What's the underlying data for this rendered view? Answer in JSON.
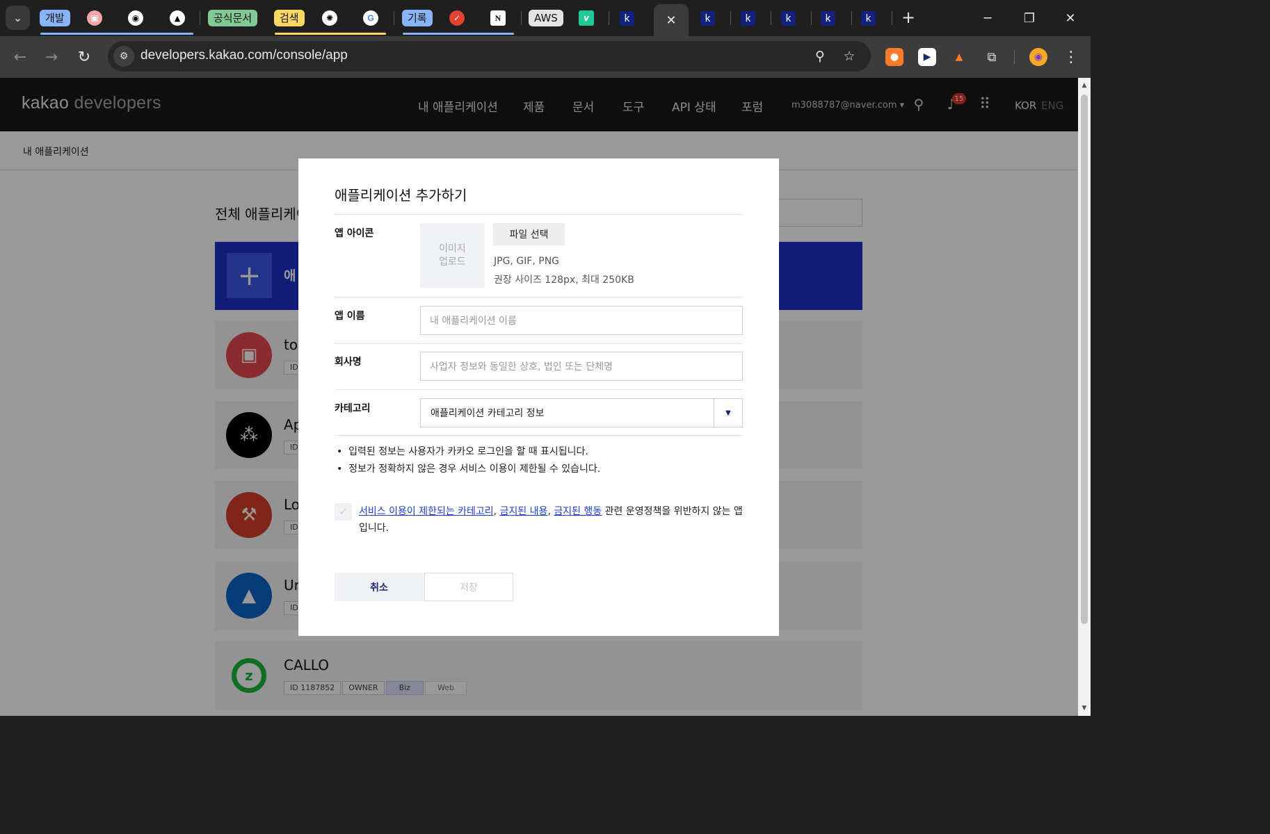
{
  "browser": {
    "tab_groups": [
      {
        "label": "개발",
        "color": "#8ab4f8"
      },
      {
        "label": "공식문서",
        "color": "#81c995"
      },
      {
        "label": "검색",
        "color": "#fdd663"
      },
      {
        "label": "기록",
        "color": "#8ab4f8"
      },
      {
        "label": "AWS",
        "color": "#e3e3e3"
      }
    ],
    "active_tab_close": "✕",
    "url": "developers.kakao.com/console/app",
    "new_tab": "+"
  },
  "header": {
    "logo_main": "kakao",
    "logo_sub": "developers",
    "nav": [
      "내 애플리케이션",
      "제품",
      "문서",
      "도구",
      "API 상태",
      "포럼"
    ],
    "email": "m3088787@naver.com",
    "email_caret": "▾",
    "notification_count": "15",
    "lang_kor": "KOR",
    "lang_eng": "ENG"
  },
  "breadcrumb": "내 애플리케이션",
  "page_title": "전체 애플리케이",
  "add_card_label": "애",
  "apps": [
    {
      "name": "toy",
      "color": "#e6484f",
      "icon": "gift-icon",
      "tags": [
        "ID"
      ]
    },
    {
      "name": "Ap",
      "color": "#000000",
      "icon": "dots-icon",
      "tags": [
        "ID"
      ]
    },
    {
      "name": "Lo",
      "color": "#d43e2a",
      "icon": "gavel-icon",
      "tags": [
        "ID"
      ]
    },
    {
      "name": "Ur",
      "color": "#0a64c7",
      "icon": "graduation-cap-icon",
      "tags": [
        "ID"
      ]
    },
    {
      "name": "CALLO",
      "color": "#19b83c",
      "icon": "callo-logo",
      "tags": [
        "ID 1187852",
        "OWNER",
        "Biz",
        "Web"
      ]
    }
  ],
  "modal": {
    "title": "애플리케이션 추가하기",
    "icon_label": "앱 아이콘",
    "image_upload": "이미지 업로드",
    "file_button": "파일 선택",
    "file_hint_1": "JPG, GIF, PNG",
    "file_hint_2": "권장 사이즈 128px, 최대 250KB",
    "name_label": "앱 이름",
    "name_placeholder": "내 애플리케이션 이름",
    "company_label": "회사명",
    "company_placeholder": "사업자 정보와 동일한 상호, 법인 또는 단체명",
    "category_label": "카테고리",
    "category_value": "애플리케이션 카테고리 정보",
    "note_1": "입력된 정보는 사용자가 카카오 로그인을 할 때 표시됩니다.",
    "note_2": "정보가 정확하지 않은 경우 서비스 이용이 제한될 수 있습니다.",
    "agree_link_1": "서비스 이용이 제한되는 카테고리",
    "agree_link_2": "금지된 내용",
    "agree_link_3": "금지된 행동",
    "agree_rest": "관련 운영정책을 위반하지 않는 앱입니다.",
    "cancel": "취소",
    "save": "저장"
  }
}
